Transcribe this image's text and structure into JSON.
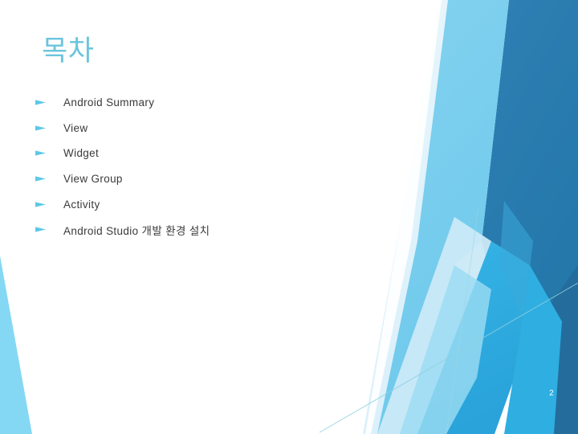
{
  "slide": {
    "title": "목차",
    "title_color": "#6cc5dd",
    "number": "2",
    "number_color": "#ffffff",
    "background_color": "#ffffff"
  },
  "body": {
    "text_color": "#3a3a3a",
    "bullet_color": "#5bc8e8",
    "bullet_icon": "triangle-right-icon",
    "items": [
      {
        "label": "Android Summary"
      },
      {
        "label": "View"
      },
      {
        "label": "Widget"
      },
      {
        "label": "View Group"
      },
      {
        "label": "Activity"
      },
      {
        "label": "Android Studio 개발 환경 설치"
      }
    ]
  },
  "decoration": {
    "name": "facet-angled-ribbons",
    "palette": {
      "pale_blue": "#e8f6fb",
      "light_blue": "#bde5f4",
      "sky_blue": "#7dd3f0",
      "bright_blue": "#3fbbea",
      "mid_blue": "#29a8dd",
      "steel_blue": "#2b8fc4",
      "dark_blue": "#2b7cad",
      "deep_blue": "#236c9c",
      "hairline": "#8fd0df",
      "corner_wedge": "#85d8f4"
    }
  }
}
